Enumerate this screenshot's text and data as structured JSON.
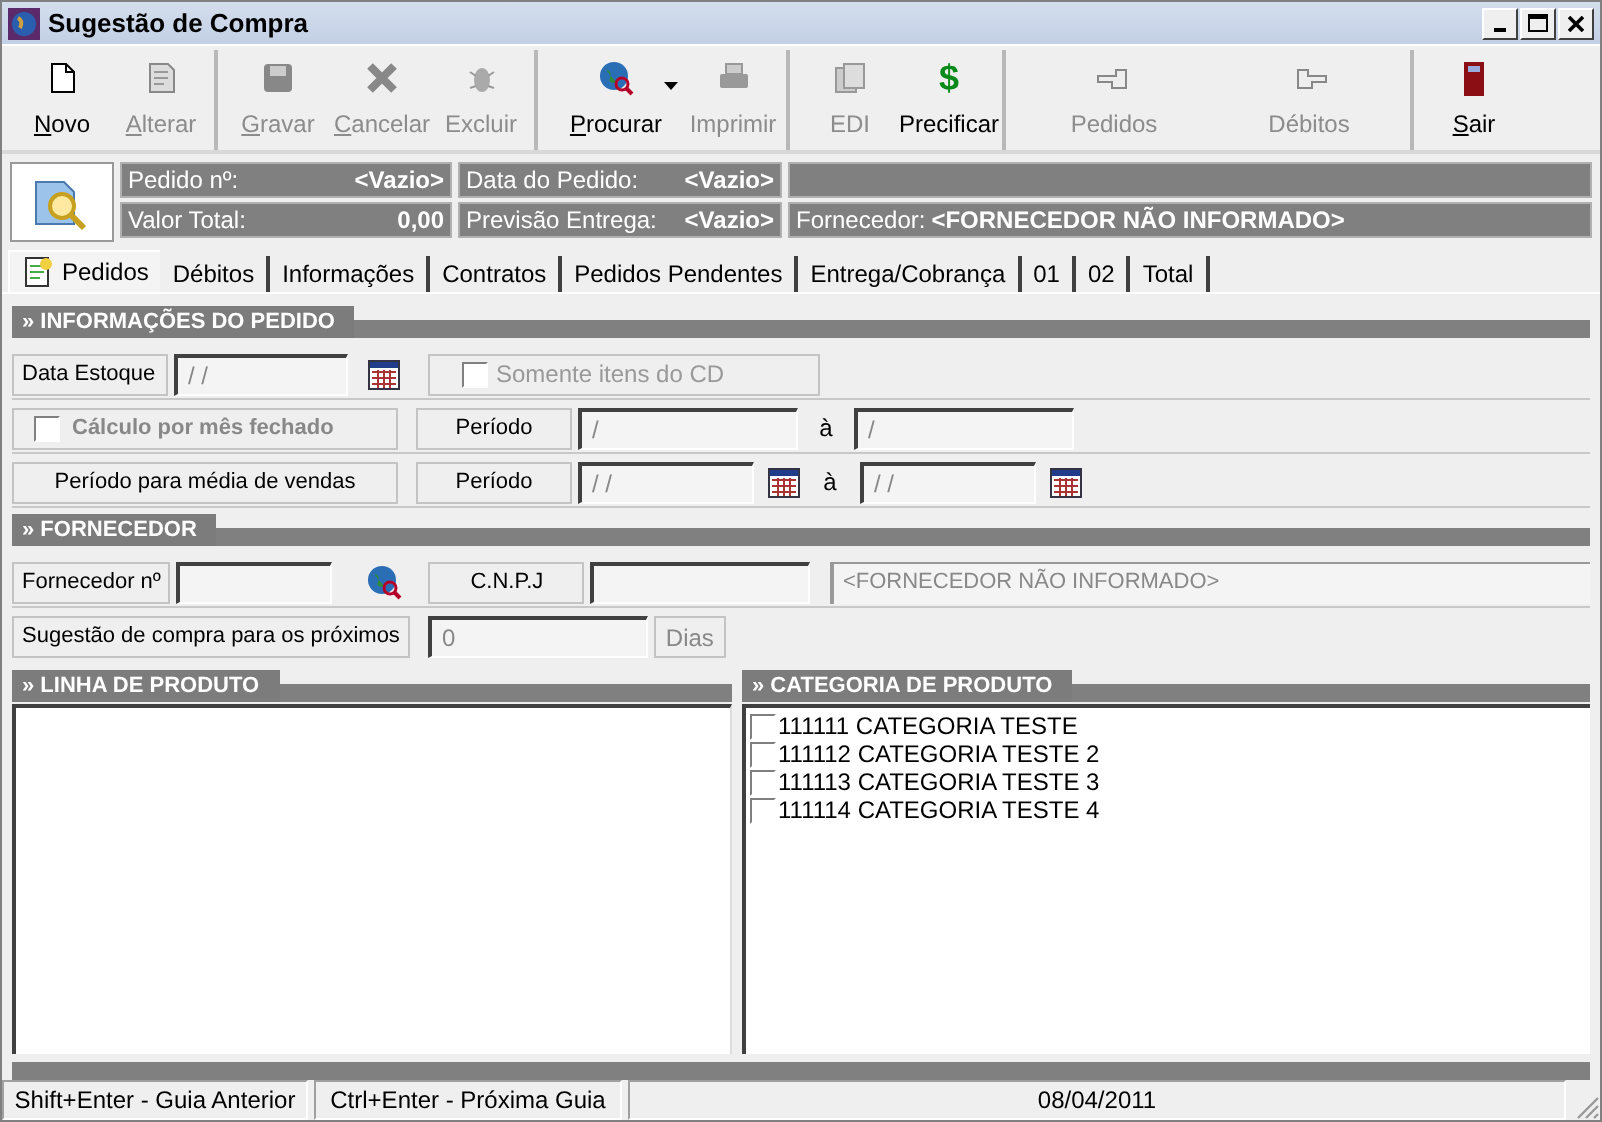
{
  "window": {
    "title": "Sugestão de Compra"
  },
  "toolbar": [
    {
      "label": "Novo",
      "disabled": false,
      "mnemonic": true,
      "separator_after": false
    },
    {
      "label": "Alterar",
      "disabled": true,
      "mnemonic": true,
      "separator_after": true
    },
    {
      "label": "Gravar",
      "disabled": true,
      "mnemonic": true,
      "separator_after": false
    },
    {
      "label": "Cancelar",
      "disabled": true,
      "mnemonic": true,
      "separator_after": false
    },
    {
      "label": "Excluir",
      "disabled": true,
      "mnemonic": false,
      "separator_after": true
    },
    {
      "label": "Procurar",
      "disabled": false,
      "mnemonic": true,
      "dropdown": true,
      "separator_after": false
    },
    {
      "label": "Imprimir",
      "disabled": true,
      "mnemonic": false,
      "separator_after": true
    },
    {
      "label": "EDI",
      "disabled": true,
      "mnemonic": false,
      "separator_after": false
    },
    {
      "label": "Precificar",
      "glyph": "$",
      "disabled": false,
      "mnemonic": false,
      "separator_after": true
    },
    {
      "label": "Pedidos",
      "disabled": true,
      "mnemonic": false,
      "separator_after": false
    },
    {
      "label": "Débitos",
      "disabled": true,
      "mnemonic": false,
      "separator_after": true
    },
    {
      "label": "Sair",
      "disabled": false,
      "mnemonic": true,
      "separator_after": false
    }
  ],
  "header": {
    "pedido_label": "Pedido nº:",
    "pedido_value": "<Vazio>",
    "data_label": "Data do Pedido:",
    "data_value": "<Vazio>",
    "total_label": "Valor Total:",
    "total_value": "0,00",
    "previsao_label": "Previsão Entrega:",
    "previsao_value": "<Vazio>",
    "fornecedor_label": "Fornecedor:",
    "fornecedor_value": "<FORNECEDOR NÃO INFORMADO>"
  },
  "tabs": [
    {
      "label": "Pedidos",
      "selected": true
    },
    {
      "label": "Débitos",
      "selected": false
    },
    {
      "label": "Informações",
      "selected": false
    },
    {
      "label": "Contratos",
      "selected": false
    },
    {
      "label": "Pedidos Pendentes",
      "selected": false
    },
    {
      "label": "Entrega/Cobrança",
      "selected": false
    },
    {
      "label": "01",
      "selected": false
    },
    {
      "label": "02",
      "selected": false
    },
    {
      "label": "Total",
      "selected": false
    }
  ],
  "order_info": {
    "title": "» INFORMAÇÕES DO PEDIDO",
    "data_estoque": {
      "label": "Data Estoque",
      "value": "/ /"
    },
    "somente_cd": {
      "label": "Somente itens do CD",
      "checked": false,
      "disabled": true
    },
    "calculo": {
      "label": "Cálculo por mês fechado",
      "checked": false,
      "disabled": true
    },
    "periodo": {
      "label": "Período",
      "from": "/",
      "to_label": "à",
      "to": "/"
    },
    "media": {
      "label": "Período para média de vendas",
      "periodo_label": "Período",
      "from": "/ /",
      "to_label": "à",
      "to": "/ /"
    }
  },
  "supplier": {
    "title": "» FORNECEDOR",
    "number_label": "Fornecedor nº",
    "cnpj_label": "C.N.P.J",
    "name_value": "<FORNECEDOR NÃO INFORMADO>",
    "suggestion_label": "Sugestão de compra para os próximos",
    "suggestion_value": "0",
    "suggestion_unit": "Dias"
  },
  "product_line": {
    "title": "» LINHA DE PRODUTO"
  },
  "product_category": {
    "title": "» CATEGORIA DE PRODUTO",
    "items": [
      {
        "label": "111111 CATEGORIA TESTE",
        "checked": false
      },
      {
        "label": "111112 CATEGORIA TESTE 2",
        "checked": false
      },
      {
        "label": "111113 CATEGORIA TESTE 3",
        "checked": false
      },
      {
        "label": "111114 CATEGORIA TESTE 4",
        "checked": false
      }
    ]
  },
  "status_bar": [
    "Shift+Enter - Guia Anterior",
    "Ctrl+Enter - Próxima Guia",
    "08/04/2011"
  ]
}
